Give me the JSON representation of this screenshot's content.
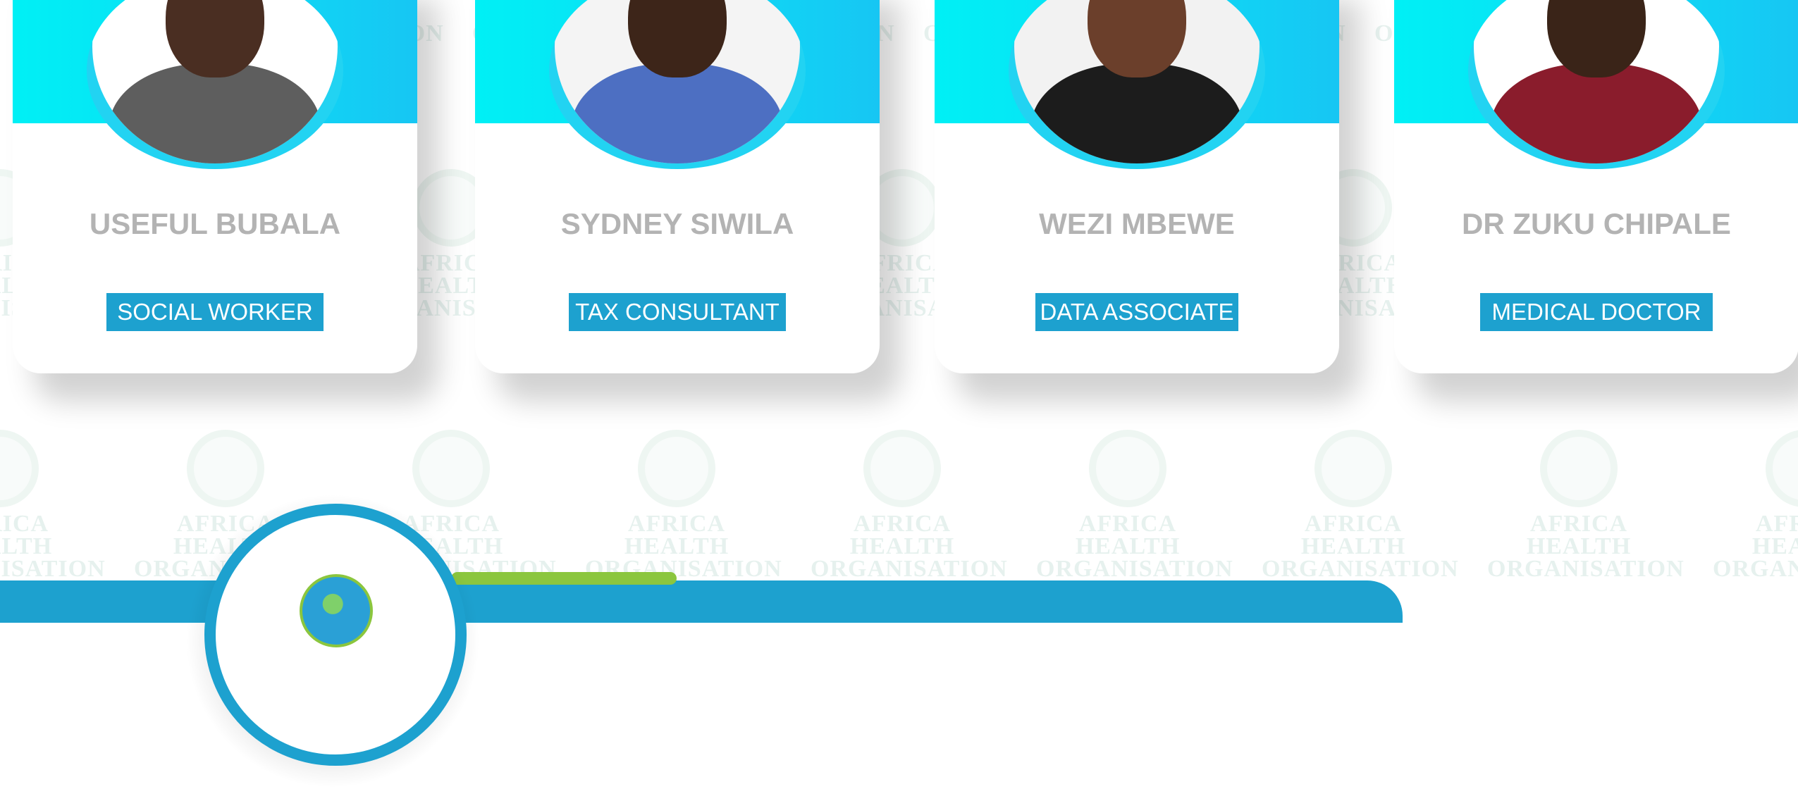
{
  "colors": {
    "banner_cyan": "#00f0f5",
    "ring_cyan": "#22d3f2",
    "role_blue": "#1da1cf",
    "name_grey": "#b3b3b3",
    "accent_green": "#8bc63e"
  },
  "watermark": {
    "line1": "AFRICA HEALTH",
    "line2": "ORGANISATION"
  },
  "team": [
    {
      "name": "USEFUL BUBALA",
      "role": "SOCIAL WORKER"
    },
    {
      "name": "SYDNEY SIWILA",
      "role": "TAX CONSULTANT"
    },
    {
      "name": "WEZI MBEWE",
      "role": "DATA ASSOCIATE"
    },
    {
      "name": "DR ZUKU CHIPALE",
      "role": "MEDICAL DOCTOR"
    }
  ],
  "footer": {
    "logo_icon": "globe-logo-icon"
  }
}
